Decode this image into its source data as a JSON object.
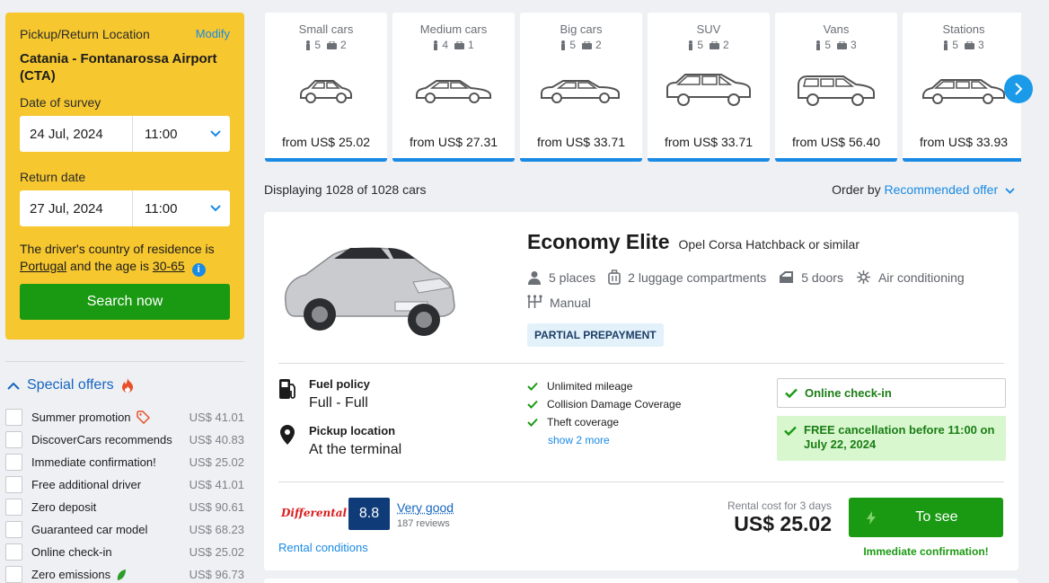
{
  "search": {
    "location_label": "Pickup/Return Location",
    "modify_label": "Modify",
    "location": "Catania - Fontanarossa Airport (CTA)",
    "survey_label": "Date of survey",
    "survey_date": "24 Jul, 2024",
    "survey_time": "11:00",
    "return_label": "Return date",
    "return_date": "27 Jul, 2024",
    "return_time": "11:00",
    "country_prefix": "The driver's country of residence is",
    "country": "Portugal",
    "age_prefix": "and the age is",
    "age": "30-65",
    "info_icon": "i",
    "search_button": "Search now"
  },
  "special_offers": {
    "title": "Special offers",
    "items": [
      {
        "label": "Summer promotion",
        "price": "US$ 41.01",
        "icon": "tag-icon"
      },
      {
        "label": "DiscoverCars recommends",
        "price": "US$ 40.83"
      },
      {
        "label": "Immediate confirmation!",
        "price": "US$ 25.02"
      },
      {
        "label": "Free additional driver",
        "price": "US$ 41.01"
      },
      {
        "label": "Zero deposit",
        "price": "US$ 90.61"
      },
      {
        "label": "Guaranteed car model",
        "price": "US$ 68.23"
      },
      {
        "label": "Online check-in",
        "price": "US$ 25.02"
      },
      {
        "label": "Zero emissions",
        "price": "US$ 96.73",
        "icon": "leaf-icon"
      }
    ]
  },
  "categories": [
    {
      "name": "Small cars",
      "seats": "5",
      "bags": "2",
      "price": "from US$ 25.02"
    },
    {
      "name": "Medium cars",
      "seats": "4",
      "bags": "1",
      "price": "from US$ 27.31"
    },
    {
      "name": "Big cars",
      "seats": "5",
      "bags": "2",
      "price": "from US$ 33.71"
    },
    {
      "name": "SUV",
      "seats": "5",
      "bags": "2",
      "price": "from US$ 33.71"
    },
    {
      "name": "Vans",
      "seats": "5",
      "bags": "3",
      "price": "from US$ 56.40"
    },
    {
      "name": "Stations",
      "seats": "5",
      "bags": "3",
      "price": "from US$ 33.93"
    }
  ],
  "results_header": {
    "displaying": "Displaying 1028 of 1028 cars",
    "order_label": "Order by",
    "order_value": "Recommended offer"
  },
  "offer": {
    "name": "Economy Elite",
    "model": "Opel Corsa Hatchback or similar",
    "places": "5 places",
    "luggage": "2 luggage compartments",
    "doors": "5 doors",
    "ac": "Air conditioning",
    "transmission": "Manual",
    "prepayment": "PARTIAL PREPAYMENT",
    "fuel_title": "Fuel policy",
    "fuel_value": "Full - Full",
    "pickup_title": "Pickup location",
    "pickup_value": "At the terminal",
    "features": [
      "Unlimited mileage",
      "Collision Damage Coverage",
      "Theft coverage"
    ],
    "show_more": "show 2 more",
    "online_checkin": "Online check-in",
    "free_cancel": "FREE cancellation before 11:00 on July 22, 2024",
    "supplier": "Differental",
    "score": "8.8",
    "rating_label": "Very good",
    "reviews": "187 reviews",
    "conditions": "Rental conditions",
    "cost_label": "Rental cost for 3 days",
    "cost": "US$ 25.02",
    "see_button": "To see",
    "immediate": "Immediate confirmation!"
  },
  "colors": {
    "accent": "#1a8ae5",
    "panel": "#f6c72f",
    "green": "#1a9a12"
  }
}
